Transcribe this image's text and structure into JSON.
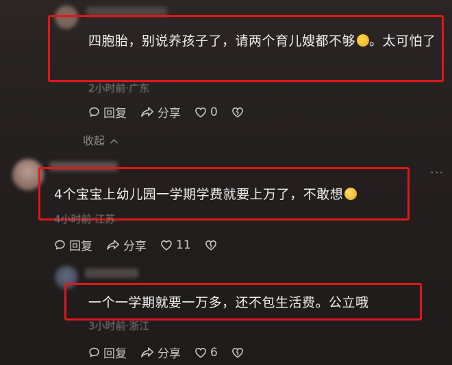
{
  "comments": [
    {
      "text": "四胞胎，别说养孩子了，请两个育儿嫂都不够",
      "text_end": "。太可怕了",
      "meta": "2小时前·广东",
      "reply_label": "回复",
      "share_label": "分享",
      "like_count": "0"
    },
    {
      "text": "4个宝宝上幼儿园一学期学费就要上万了，不敢想",
      "meta": "4小时前·江苏",
      "reply_label": "回复",
      "share_label": "分享",
      "like_count": "11"
    },
    {
      "text": "一个一学期就要一万多，还不包生活费。公立哦",
      "meta": "3小时前·浙江",
      "reply_label": "回复",
      "share_label": "分享",
      "like_count": "6"
    }
  ],
  "collapse_label": "收起",
  "more_label": "···",
  "colors": {
    "highlight": "#e0161b",
    "background": "#241f1f"
  }
}
